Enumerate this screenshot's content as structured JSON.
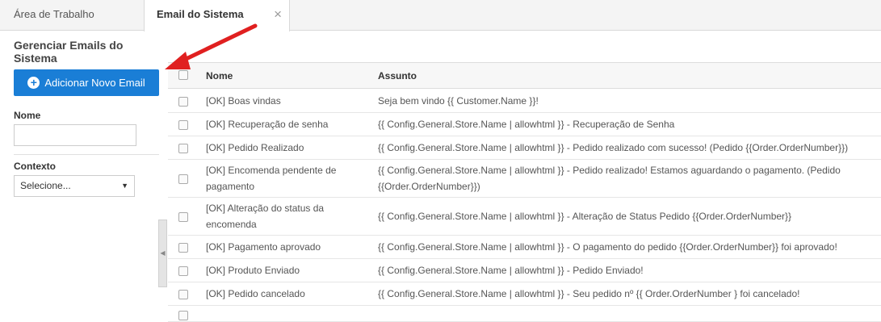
{
  "tabs": [
    {
      "label": "Área de Trabalho"
    },
    {
      "label": "Email do Sistema",
      "close": "×"
    }
  ],
  "sidebar": {
    "title": "Gerenciar Emails do Sistema",
    "add_button": "Adicionar Novo Email",
    "name_label": "Nome",
    "name_value": "",
    "context_label": "Contexto",
    "context_selected": "Selecione..."
  },
  "table": {
    "columns": [
      "Nome",
      "Assunto"
    ],
    "rows": [
      {
        "name": "[OK] Boas vindas",
        "subject": "Seja bem vindo {{ Customer.Name }}!"
      },
      {
        "name": "[OK] Recuperação de senha",
        "subject": "{{ Config.General.Store.Name | allowhtml }} - Recuperação de Senha"
      },
      {
        "name": "[OK] Pedido Realizado",
        "subject": "{{ Config.General.Store.Name | allowhtml }} - Pedido realizado com sucesso! (Pedido {{Order.OrderNumber}})"
      },
      {
        "name": "[OK] Encomenda pendente de pagamento",
        "subject": "{{ Config.General.Store.Name | allowhtml }} - Pedido realizado! Estamos aguardando o pagamento. (Pedido {{Order.OrderNumber}})"
      },
      {
        "name": "[OK] Alteração do status da encomenda",
        "subject": "{{ Config.General.Store.Name | allowhtml }} - Alteração de Status Pedido {{Order.OrderNumber}}"
      },
      {
        "name": "[OK] Pagamento aprovado",
        "subject": "{{ Config.General.Store.Name | allowhtml }} - O pagamento do pedido {{Order.OrderNumber}} foi aprovado!"
      },
      {
        "name": "[OK] Produto Enviado",
        "subject": "{{ Config.General.Store.Name | allowhtml }} - Pedido Enviado!"
      },
      {
        "name": "[OK] Pedido cancelado",
        "subject": "{{ Config.General.Store.Name | allowhtml }} - Seu pedido nº {{ Order.OrderNumber } foi cancelado!"
      }
    ]
  },
  "colors": {
    "accent": "#1a7ed6",
    "annotation_arrow": "#e02020"
  }
}
